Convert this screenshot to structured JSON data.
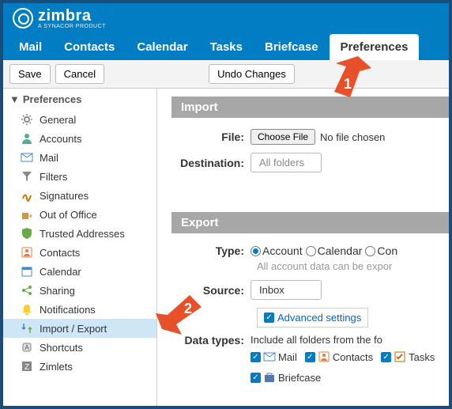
{
  "logo": {
    "text": "zimbra",
    "sub": "A SYNACOR PRODUCT"
  },
  "tabs": [
    "Mail",
    "Contacts",
    "Calendar",
    "Tasks",
    "Briefcase",
    "Preferences"
  ],
  "activeTab": 5,
  "toolbar": {
    "save": "Save",
    "cancel": "Cancel",
    "undo": "Undo Changes"
  },
  "sidebar": {
    "head": "Preferences",
    "items": [
      {
        "icon": "gear",
        "label": "General"
      },
      {
        "icon": "user",
        "label": "Accounts"
      },
      {
        "icon": "mail",
        "label": "Mail"
      },
      {
        "icon": "filter",
        "label": "Filters"
      },
      {
        "icon": "sign",
        "label": "Signatures"
      },
      {
        "icon": "out",
        "label": "Out of Office"
      },
      {
        "icon": "shield",
        "label": "Trusted Addresses"
      },
      {
        "icon": "contact",
        "label": "Contacts"
      },
      {
        "icon": "cal",
        "label": "Calendar"
      },
      {
        "icon": "share",
        "label": "Sharing"
      },
      {
        "icon": "bell",
        "label": "Notifications"
      },
      {
        "icon": "impexp",
        "label": "Import / Export"
      },
      {
        "icon": "key",
        "label": "Shortcuts"
      },
      {
        "icon": "zim",
        "label": "Zimlets"
      }
    ],
    "activeIndex": 11
  },
  "import": {
    "head": "Import",
    "fileLabel": "File:",
    "chooseFile": "Choose File",
    "noFile": "No file chosen",
    "destLabel": "Destination:",
    "destValue": "All folders"
  },
  "export": {
    "head": "Export",
    "typeLabel": "Type:",
    "typeOptions": [
      "Account",
      "Calendar",
      "Con"
    ],
    "typeSelected": 0,
    "typeHint": "All account data can be expor",
    "sourceLabel": "Source:",
    "sourceValue": "Inbox",
    "advanced": "Advanced settings",
    "dataTypesLabel": "Data types:",
    "dataTypesHint": "Include all folders from the fo",
    "types": [
      {
        "icon": "mail",
        "label": "Mail",
        "checked": true
      },
      {
        "icon": "contact",
        "label": "Contacts",
        "checked": true
      },
      {
        "icon": "task",
        "label": "Tasks",
        "checked": true
      },
      {
        "icon": "brief",
        "label": "Briefcase",
        "checked": true
      }
    ]
  },
  "annotations": {
    "arrow1": "1",
    "arrow2": "2"
  }
}
